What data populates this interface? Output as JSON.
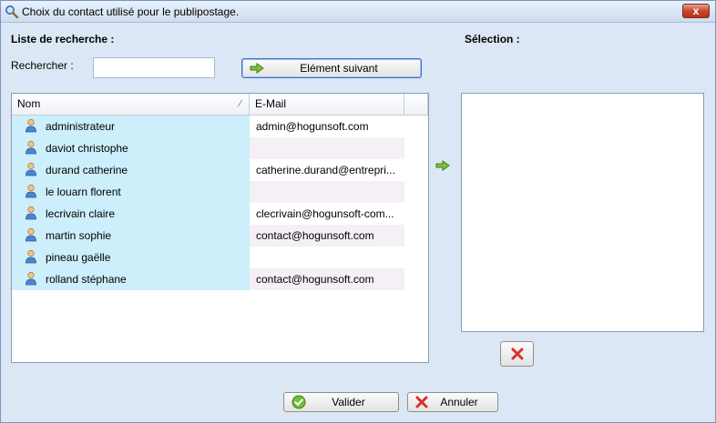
{
  "window": {
    "title": "Choix du contact utilisé pour le publipostage.",
    "close_label": "x"
  },
  "search": {
    "list_label": "Liste de recherche :",
    "search_label": "Rechercher :",
    "input_value": "",
    "next_button_label": "Elément suivant"
  },
  "selection": {
    "label": "Sélection :"
  },
  "grid": {
    "columns": [
      "Nom",
      "E-Mail"
    ],
    "sort_indicator": "⁄",
    "rows": [
      {
        "nom": "administrateur",
        "email": "admin@hogunsoft.com"
      },
      {
        "nom": "daviot christophe",
        "email": ""
      },
      {
        "nom": "durand catherine",
        "email": "catherine.durand@entrepri..."
      },
      {
        "nom": "le louarn florent",
        "email": ""
      },
      {
        "nom": "lecrivain claire",
        "email": "clecrivain@hogunsoft-com..."
      },
      {
        "nom": "martin sophie",
        "email": "contact@hogunsoft.com"
      },
      {
        "nom": "pineau gaëlle",
        "email": ""
      },
      {
        "nom": "rolland stéphane",
        "email": "contact@hogunsoft.com"
      }
    ]
  },
  "footer": {
    "validate_label": "Valider",
    "cancel_label": "Annuler"
  },
  "colors": {
    "row_nom_bg": "#cdeefb",
    "row_alt_email_bg": "#f5f0f6",
    "accent_green": "#5ca61c",
    "accent_red": "#d8312a"
  },
  "icons": {
    "title": "search-contact-icon",
    "user": "user-icon",
    "next": "green-arrow-icon",
    "transfer": "green-arrow-icon",
    "remove": "red-cross-icon",
    "validate": "green-check-icon",
    "cancel": "red-cross-icon"
  }
}
